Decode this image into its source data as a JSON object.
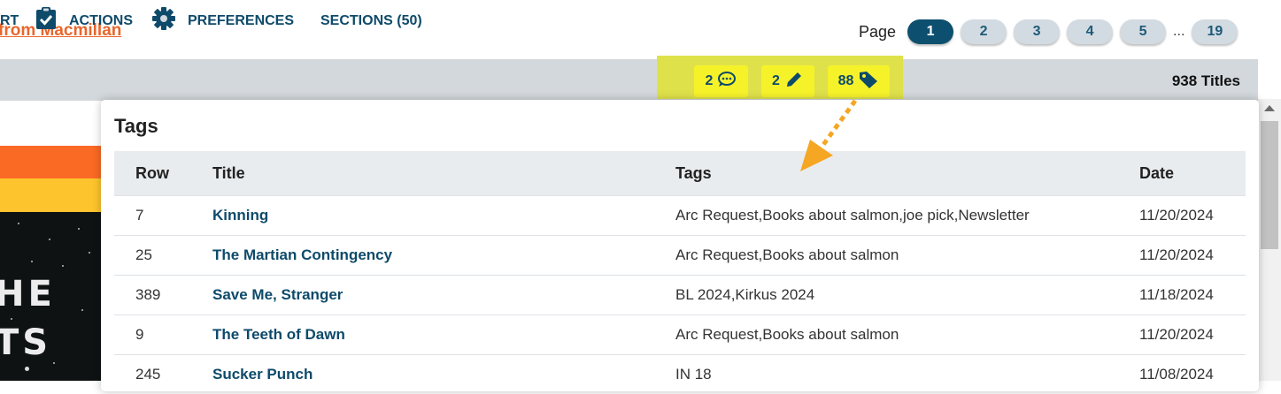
{
  "header": {
    "catalog_link": "from Macmillan"
  },
  "pagination": {
    "label": "Page",
    "pages": [
      "1",
      "2",
      "3",
      "4",
      "5"
    ],
    "ellipsis": "...",
    "last_page": "19",
    "current": "1"
  },
  "toolbar": {
    "export_partial": "RT",
    "actions": "ACTIONS",
    "preferences": "PREFERENCES",
    "sections": "SECTIONS (50)",
    "badges": {
      "comments": "2",
      "notes": "2",
      "tags": "88"
    },
    "titles_count": "938 Titles"
  },
  "cover_art": {
    "line1": "HE",
    "line2": "TS"
  },
  "tags_popup": {
    "title": "Tags",
    "columns": [
      "Row",
      "Title",
      "Tags",
      "Date"
    ],
    "rows": [
      {
        "row": "7",
        "title": "Kinning",
        "tags": "Arc Request,Books about salmon,joe pick,Newsletter",
        "date": "11/20/2024"
      },
      {
        "row": "25",
        "title": "The Martian Contingency",
        "tags": "Arc Request,Books about salmon",
        "date": "11/20/2024"
      },
      {
        "row": "389",
        "title": "Save Me, Stranger",
        "tags": "BL 2024,Kirkus 2024",
        "date": "11/18/2024"
      },
      {
        "row": "9",
        "title": "The Teeth of Dawn",
        "tags": "Arc Request,Books about salmon",
        "date": "11/20/2024"
      },
      {
        "row": "245",
        "title": "Sucker Punch",
        "tags": "IN 18",
        "date": "11/08/2024"
      }
    ]
  },
  "colors": {
    "brand_orange": "#e8662c",
    "brand_navy": "#0d4f6e",
    "highlight_yellow": "#f6f22a",
    "arrow_orange": "#f5a623"
  }
}
